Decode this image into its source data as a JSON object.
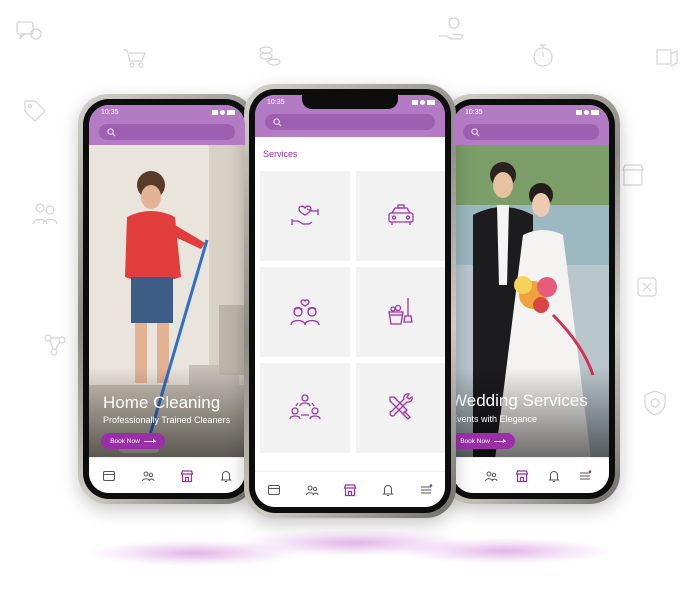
{
  "colors": {
    "accent": "#9b2fa8",
    "header": "#b37bc4",
    "search": "#9d60b0",
    "tile": "#f2f2f2"
  },
  "phones": {
    "left": {
      "time": "10:35",
      "hero_title": "Home Cleaning",
      "hero_subtitle": "Professionally Trained Cleaners",
      "book_label": "Book Now"
    },
    "center": {
      "time": "10:35",
      "section_title": "Services",
      "tiles": [
        {
          "icon": "care-hands-icon"
        },
        {
          "icon": "taxi-icon"
        },
        {
          "icon": "couple-icon"
        },
        {
          "icon": "cleaning-bucket-icon"
        },
        {
          "icon": "networking-icon"
        },
        {
          "icon": "repair-tools-icon"
        }
      ]
    },
    "right": {
      "time": "10:35",
      "hero_title": "Wedding Services",
      "hero_subtitle": "Events with Elegance",
      "book_label": "Book Now"
    }
  },
  "bottom_nav": [
    {
      "icon": "card-icon"
    },
    {
      "icon": "users-icon"
    },
    {
      "icon": "store-icon"
    },
    {
      "icon": "bell-icon"
    },
    {
      "icon": "menu-icon"
    }
  ]
}
